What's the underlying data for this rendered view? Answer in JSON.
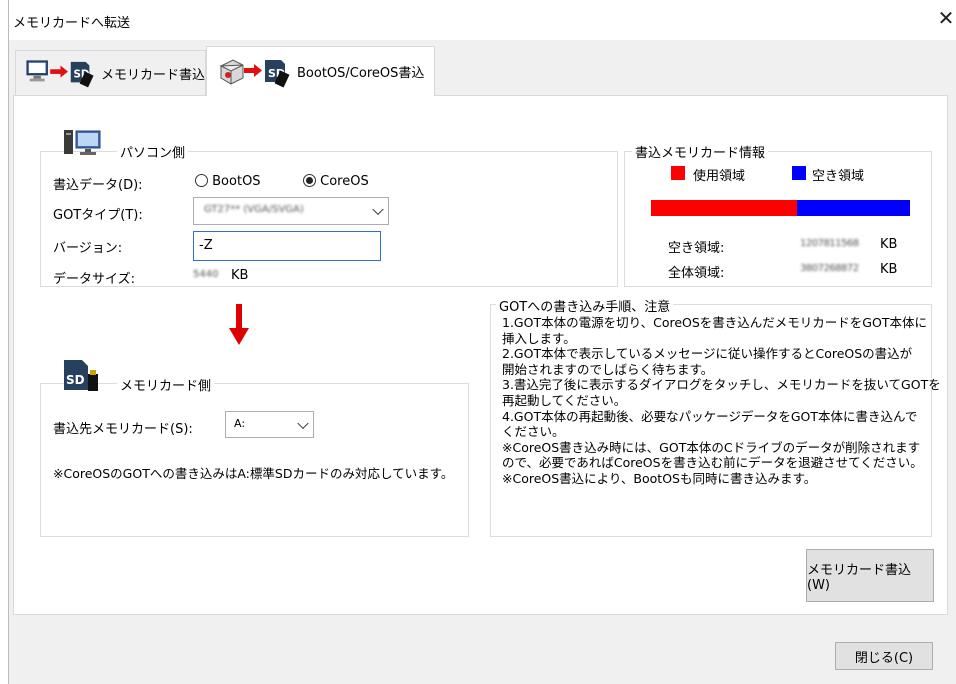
{
  "window": {
    "title": "メモリカードへ転送",
    "close_glyph": "✕"
  },
  "tabs": [
    {
      "label": "メモリカード書込",
      "active": false
    },
    {
      "label": "BootOS/CoreOS書込",
      "active": true
    }
  ],
  "pc_side": {
    "title": "パソコン側",
    "write_data_label": "書込データ(D):",
    "radio_bootos": "BootOS",
    "radio_coreos": "CoreOS",
    "selected": "CoreOS",
    "got_type_label": "GOTタイプ(T):",
    "got_type_value": "GT27** (VGA/SVGA)",
    "version_label": "バージョン:",
    "version_value": "-Z",
    "data_size_label": "データサイズ:",
    "data_size_value": "5440",
    "data_size_unit": "KB"
  },
  "card_info": {
    "title": "書込メモリカード情報",
    "legend_used": "使用領域",
    "legend_free": "空き領域",
    "used_color": "#ff0000",
    "free_color": "#0000ff",
    "used_fraction": 0.565,
    "free_label": "空き領域:",
    "free_value": "1207811568",
    "total_label": "全体領域:",
    "total_value": "3807268872",
    "unit": "KB"
  },
  "card_side": {
    "title": "メモリカード側",
    "dest_label": "書込先メモリカード(S):",
    "dest_value": "A:",
    "note": "※CoreOSのGOTへの書き込みはA:標準SDカードのみ対応しています。"
  },
  "procedure": {
    "title": "GOTへの書き込み手順、注意",
    "lines": [
      "1.GOT本体の電源を切り、CoreOSを書き込んだメモリカードをGOT本体に",
      "挿入します。",
      "2.GOT本体で表示しているメッセージに従い操作するとCoreOSの書込が",
      "開始されますのでしばらく待ちます。",
      "3.書込完了後に表示するダイアログをタッチし、メモリカードを抜いてGOTを",
      "再起動してください。",
      "4.GOT本体の再起動後、必要なパッケージデータをGOT本体に書き込んで",
      "ください。",
      " ※CoreOS書き込み時には、GOT本体のCドライブのデータが削除されます",
      "ので、必要であればCoreOSを書き込む前にデータを退避させてください。",
      " ※CoreOS書込により、BootOSも同時に書き込みます。"
    ]
  },
  "buttons": {
    "write": "メモリカード書込(W)",
    "close": "閉じる(C)"
  }
}
